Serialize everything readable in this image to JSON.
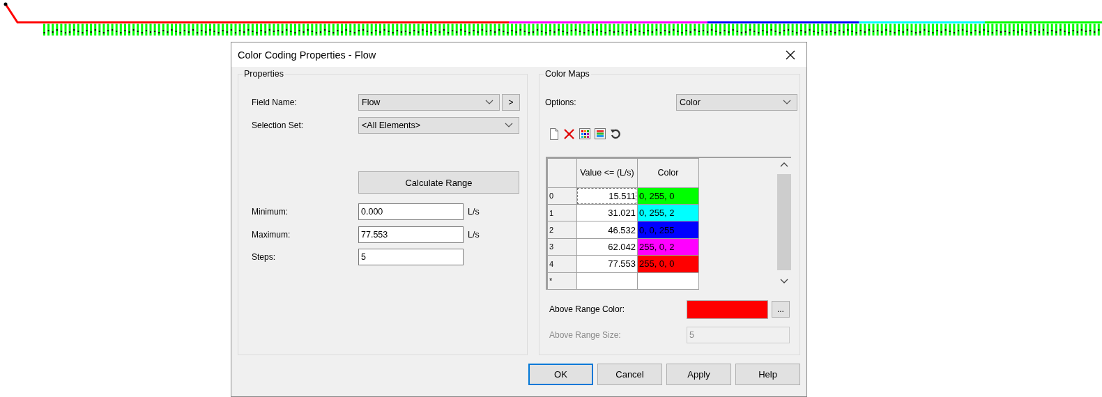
{
  "window": {
    "title": "Color Coding Properties - Flow"
  },
  "properties": {
    "title": "Properties",
    "field_name": {
      "label": "Field Name:",
      "value": "Flow",
      "button": ">"
    },
    "selection_set": {
      "label": "Selection Set:",
      "value": "<All Elements>"
    },
    "calculate_button": "Calculate Range",
    "minimum": {
      "label": "Minimum:",
      "value": "0.000",
      "unit": "L/s"
    },
    "maximum": {
      "label": "Maximum:",
      "value": "77.553",
      "unit": "L/s"
    },
    "steps": {
      "label": "Steps:",
      "value": "5"
    }
  },
  "color_maps": {
    "title": "Color Maps",
    "options": {
      "label": "Options:",
      "value": "Color"
    },
    "table": {
      "columns": [
        "Value <= (L/s)",
        "Color"
      ],
      "rows": [
        {
          "index": "0",
          "value": "15.511",
          "color_text": "0, 255, 0",
          "color": "#00ff00",
          "focused": true
        },
        {
          "index": "1",
          "value": "31.021",
          "color_text": "0, 255, 2",
          "color": "#00ffff",
          "focused": false
        },
        {
          "index": "2",
          "value": "46.532",
          "color_text": "0, 0, 255",
          "color": "#0000ff",
          "focused": false
        },
        {
          "index": "3",
          "value": "62.042",
          "color_text": "255, 0, 2",
          "color": "#ff00ff",
          "focused": false
        },
        {
          "index": "4",
          "value": "77.553",
          "color_text": "255, 0, 0",
          "color": "#ff0000",
          "focused": false
        }
      ],
      "new_row": "*"
    },
    "above_range_color": {
      "label": "Above Range Color:",
      "color": "#ff0000",
      "button": "..."
    },
    "above_range_size": {
      "label": "Above Range Size:",
      "value": "5",
      "disabled": true
    }
  },
  "buttons": [
    {
      "label": "OK",
      "default": true
    },
    {
      "label": "Cancel",
      "default": false
    },
    {
      "label": "Apply",
      "default": false
    },
    {
      "label": "Help",
      "default": false
    }
  ]
}
